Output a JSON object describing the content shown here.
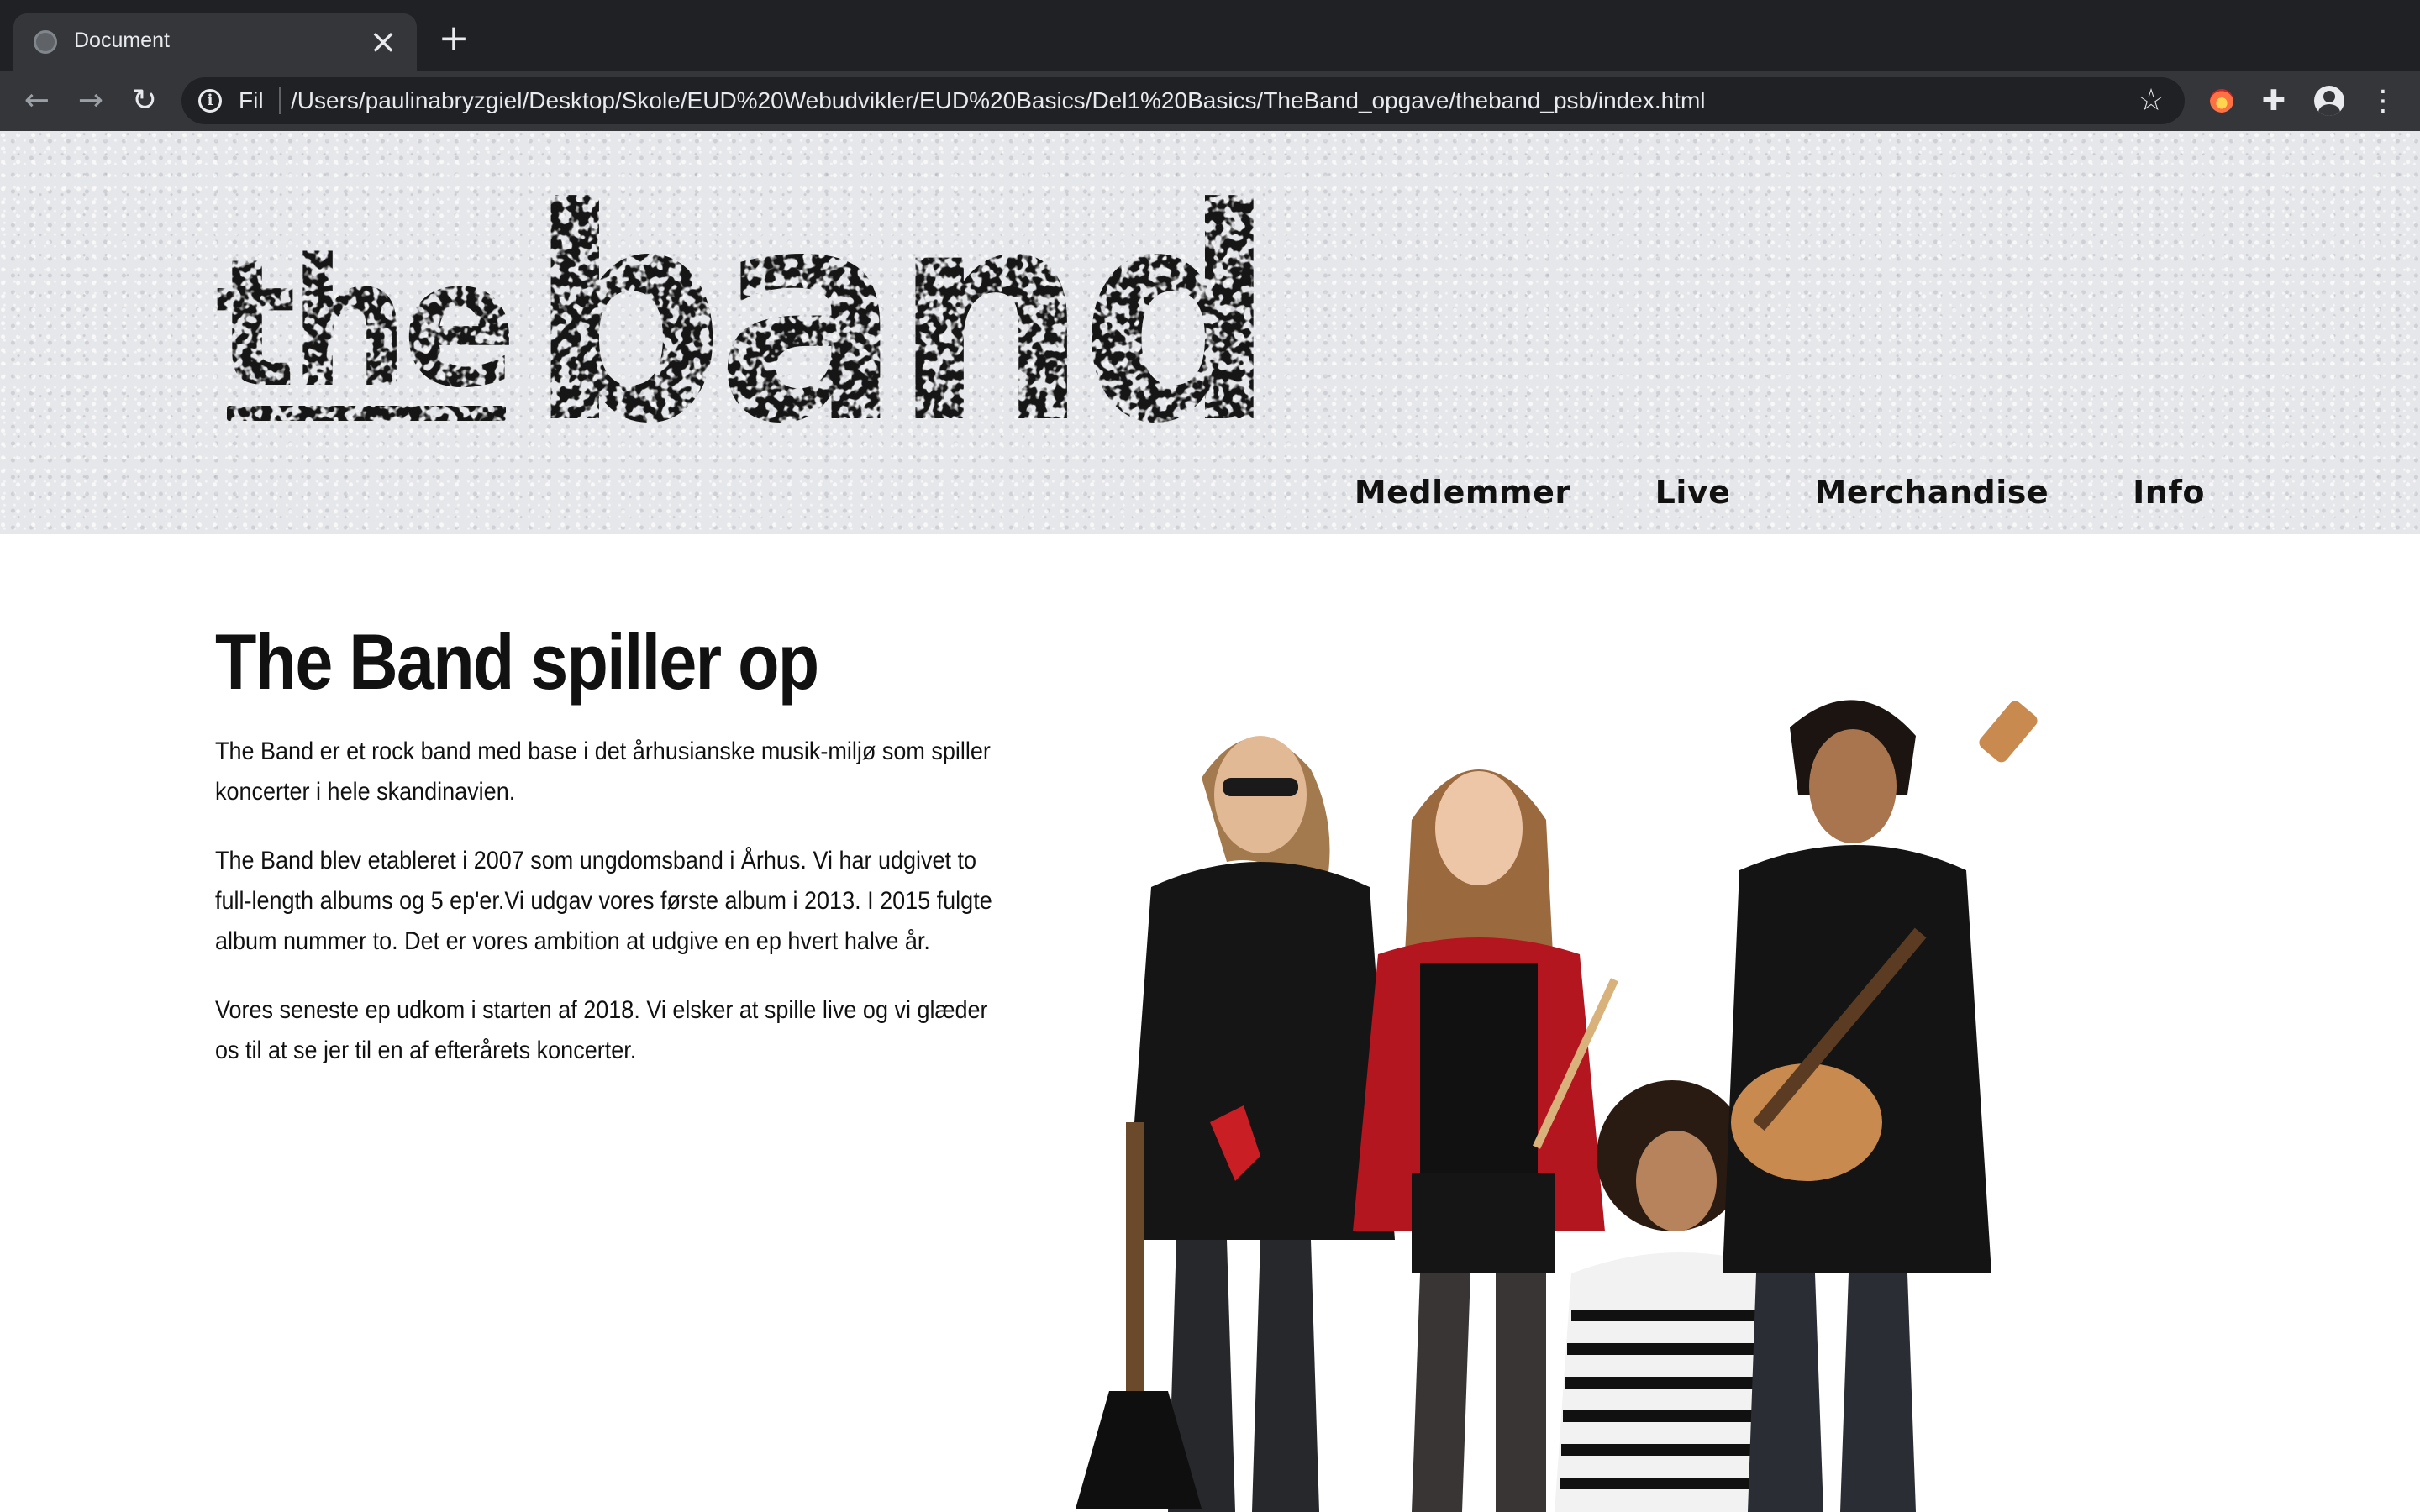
{
  "browser": {
    "tab_title": "Document",
    "tab_close": "×",
    "new_tab": "+",
    "back": "←",
    "forward": "→",
    "reload": "↻",
    "scheme_label": "Fil",
    "url": "/Users/paulinabryzgiel/Desktop/Skole/EUD%20Webudvikler/EUD%20Basics/Del1%20Basics/TheBand_opgave/theband_psb/index.html",
    "bookmark_star": "☆",
    "menu": "⋮",
    "extensions": "✚"
  },
  "site": {
    "logo": {
      "small": "the",
      "large": "band"
    },
    "nav": [
      {
        "label": "Medlemmer"
      },
      {
        "label": "Live"
      },
      {
        "label": "Merchandise"
      },
      {
        "label": "Info"
      }
    ],
    "heading": "The Band spiller op",
    "paragraphs": [
      "The Band er et rock band med base i det århusianske musik-miljø som spiller koncerter i hele skandinavien.",
      "The Band blev etableret i 2007 som ungdomsband i Århus. Vi har udgivet to full-length albums og 5 ep'er.Vi udgav vores første album i 2013. I 2015 fulgte album nummer to. Det er vores ambition at udgive en ep hvert halve år.",
      "Vores seneste ep udkom i starten af 2018. Vi elsker at spille live og vi glæder os til at se jer til en af efterårets koncerter."
    ]
  },
  "colors": {
    "chrome_dark": "#202124",
    "chrome_toolbar": "#35363a",
    "header_bg": "#e6e7ea",
    "text": "#111111"
  }
}
